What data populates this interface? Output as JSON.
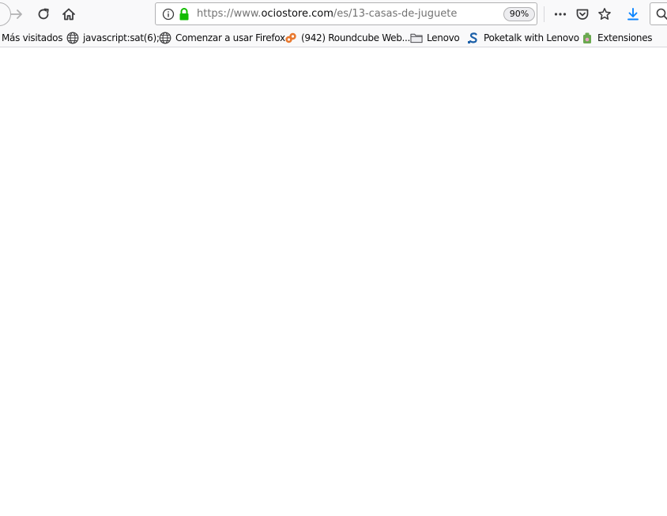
{
  "toolbar": {
    "url_prefix": "https://www.",
    "url_domain": "ociostore.com",
    "url_path": "/es/13-casas-de-juguete",
    "zoom": "90%"
  },
  "bookmarks": [
    {
      "label": "Más visitados",
      "icon": "most-visited"
    },
    {
      "label": "javascript:sat(6);",
      "icon": "globe-icon"
    },
    {
      "label": "Comenzar a usar Firefox",
      "icon": "globe-icon"
    },
    {
      "label": "(942) Roundcube Web...",
      "icon": "roundcube-icon"
    },
    {
      "label": "Lenovo",
      "icon": "folder-icon"
    },
    {
      "label": "Poketalk with Lenovo",
      "icon": "poketalk-icon"
    },
    {
      "label": "Extensiones",
      "icon": "extensions-icon"
    }
  ],
  "colors": {
    "toolbar_bg": "#f9f9fa",
    "lock_green": "#12bc00",
    "download_blue": "#0a84ff",
    "roundcube_orange": "#e8782e",
    "poketalk_blue": "#1b5fa8",
    "extensions_green": "#6aa84f"
  }
}
